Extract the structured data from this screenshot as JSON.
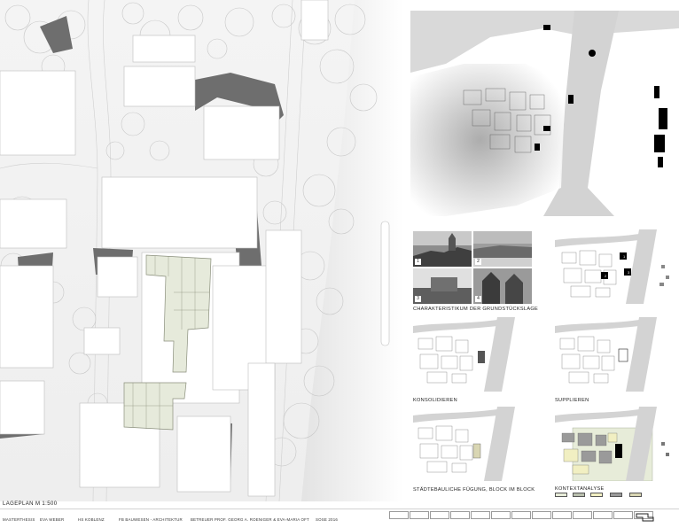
{
  "main_plan": {
    "scale_label": "LAGEPLAN M 1:500"
  },
  "photos": [
    {
      "number": "1"
    },
    {
      "number": "2"
    },
    {
      "number": "3"
    },
    {
      "number": "4"
    }
  ],
  "captions": {
    "photos": "CHARAKTERISTIKUM DER GRUNDSTÜCKSLAGE",
    "konsolidieren": "KONSOLIDIEREN",
    "supplieren": "SUPPLIEREN",
    "fuegung": "STÄDTEBAULICHE FÜGUNG, BLOCK IM BLOCK",
    "kontext": "KONTEXTANALYSE"
  },
  "diagram_labels": {
    "top_right": [
      "1",
      "2",
      "3"
    ]
  },
  "legend": {
    "colors": [
      "#e7ecd9",
      "#b9bfae",
      "#f1efc2",
      "#9a9a9a",
      "#d9d6b3"
    ]
  },
  "footer": {
    "type": "MASTERTHESIS",
    "author": "EVA WEBER",
    "school": "HS KOBLENZ",
    "department": "FB BAUWESEN - ARCHITEKTUR",
    "supervisors": "BETREUER PROF. GEORG A. ROENIGER & EVA-MARIA OFT",
    "semester": "SOSE 2016"
  },
  "nav_box_count": 13,
  "colors": {
    "river": "#d7d7d7",
    "building": "#ffffff",
    "shadow": "#6e6e6e",
    "highlight": "#e6eadb",
    "accent_block": "#000000"
  }
}
